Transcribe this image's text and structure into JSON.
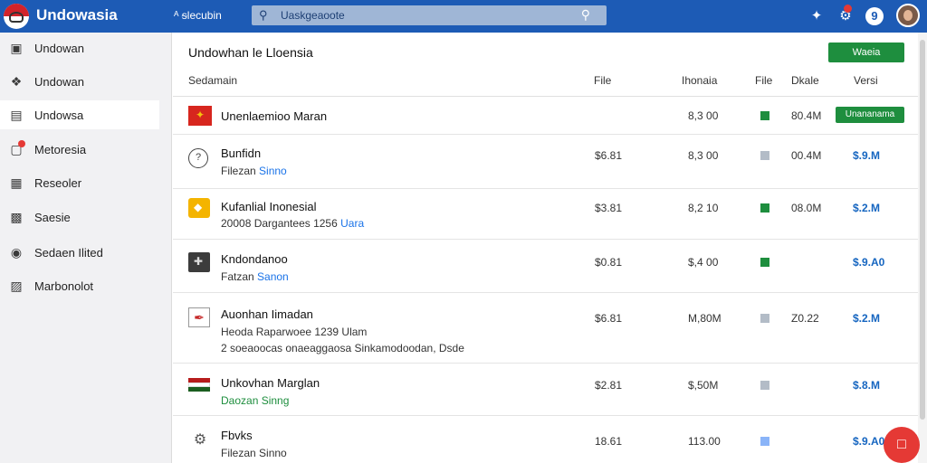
{
  "app": {
    "title": "Undowasia"
  },
  "topbar": {
    "link_label": "ᴬ ᵴlecubin",
    "search_placeholder": "Uaskgeaoote",
    "icons": [
      "puzzle-icon",
      "notification-icon",
      "help-icon",
      "avatar"
    ],
    "help_glyph": "9"
  },
  "sidebar": {
    "items": [
      {
        "label": "Undowan",
        "icon": "grid-icon"
      },
      {
        "label": "Undowan",
        "icon": "tag-icon"
      },
      {
        "label": "Undowsa",
        "icon": "bag-icon"
      },
      {
        "label": "Metoresia",
        "icon": "message-icon"
      },
      {
        "label": "Reseoler",
        "icon": "book-icon"
      },
      {
        "label": "Saesie",
        "icon": "store-icon"
      },
      {
        "label": "Sedaen Ilited",
        "icon": "globe-icon"
      },
      {
        "label": "Marbonolot",
        "icon": "settings-icon"
      }
    ]
  },
  "main": {
    "title": "Undowhan le Lloensia",
    "primary_button": "Waeia",
    "headers": {
      "name": "Sedamain",
      "c1": "File",
      "c2": "Ihonaia",
      "c3": "File",
      "c4": "Dkale",
      "c5": "Versi"
    },
    "rows": [
      {
        "title": "Unenlaemioo Maran",
        "sub": "",
        "sub_link": "",
        "sub2": "",
        "c1": "",
        "c2": "8,3 00",
        "status": "green",
        "c4": "80.4M",
        "price": "",
        "button": "Unananama"
      },
      {
        "title": "Bunfidn",
        "sub": "Filezan",
        "sub_link": "Sinno",
        "sub2": "",
        "c1": "$6.81",
        "c2": "8,3 00",
        "status": "grey",
        "c4": "00.4M",
        "price": "$.9.M",
        "button": ""
      },
      {
        "title": "Kufanlial Inonesial",
        "sub": "20008 Dargantees 1256",
        "sub_link": "Uara",
        "sub2": "",
        "c1": "$3.81",
        "c2": "8,2 10",
        "status": "green",
        "c4": "08.0M",
        "price": "$.2.M",
        "button": ""
      },
      {
        "title": "Kndondanoo",
        "sub": "Fatzan",
        "sub_link": "Sanon",
        "sub2": "",
        "c1": "$0.81",
        "c2": "$,4 00",
        "status": "green",
        "c4": "",
        "price": "$.9.A0",
        "button": ""
      },
      {
        "title": "Auonhan Iimadan",
        "sub": "Heoda Raparwoee 1239 Ulam",
        "sub_link": "",
        "sub2": "2 soeaoocas onaeaggaosa Sinkamodoodan, Dsde",
        "c1": "$6.81",
        "c2": "M,80M",
        "status": "grey",
        "c4": "Z0.22",
        "price": "$.2.M",
        "button": ""
      },
      {
        "title": "Unkovhan Marglan",
        "sub": "Daozan Sinng",
        "sub_link": "",
        "sub2": "",
        "c1": "$2.81",
        "c2": "$,50M",
        "status": "grey",
        "c4": "",
        "price": "$.8.M",
        "button": ""
      },
      {
        "title": "Fbvks",
        "sub": "Filezan Sinno",
        "sub_link": "",
        "sub2": "",
        "c1": "18.61",
        "c2": "113.00",
        "status": "blue",
        "c4": "",
        "price": "$.9.A0",
        "button": ""
      }
    ]
  },
  "colors": {
    "topbar": "#1d5bb5",
    "accent_green": "#1e8e3e",
    "price_blue": "#1565c0",
    "fab_red": "#e53935"
  }
}
